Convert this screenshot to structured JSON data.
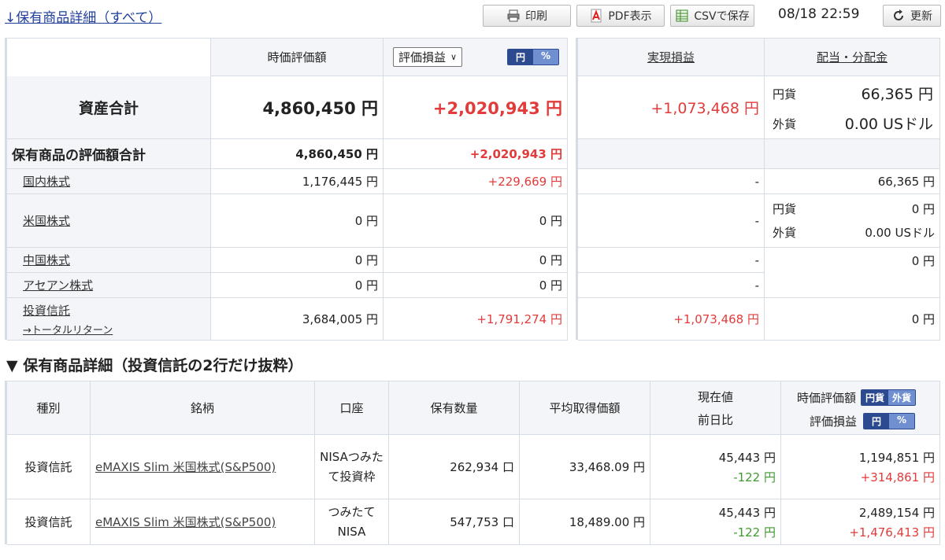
{
  "top": {
    "link": "↓保有商品詳細（すべて）",
    "print": "印刷",
    "pdf": "PDF表示",
    "csv": "CSVで保存",
    "timestamp": "08/18 22:59",
    "refresh": "更新"
  },
  "summary": {
    "col_market_value": "時価評価額",
    "col_pl_select": "評価損益",
    "toggle_yen": "円",
    "toggle_pct": "%",
    "col_realized": "実現損益",
    "col_dividend": "配当・分配金",
    "total_label": "資産合計",
    "total_value": "4,860,450 円",
    "total_pl": "+2,020,943 円",
    "total_realized": "+1,073,468 円",
    "div_yen_label": "円貨",
    "div_yen_value": "66,365 円",
    "div_fx_label": "外貨",
    "div_fx_value": "0.00 USドル",
    "holdings_label": "保有商品の評価額合計",
    "holdings_value": "4,860,450 円",
    "holdings_pl": "+2,020,943 円",
    "rows": [
      {
        "label": "国内株式",
        "value": "1,176,445 円",
        "pl": "+229,669 円",
        "realized": "-",
        "dividend": "66,365 円"
      },
      {
        "label": "米国株式",
        "value": "0 円",
        "pl": "0 円",
        "realized": "-",
        "div_yen_label": "円貨",
        "div_yen": "0 円",
        "div_fx_label": "外貨",
        "div_fx": "0.00 USドル"
      },
      {
        "label": "中国株式",
        "value": "0 円",
        "pl": "0 円",
        "realized": "-",
        "dividend": "0 円"
      },
      {
        "label": "アセアン株式",
        "value": "0 円",
        "pl": "0 円",
        "realized": "-"
      },
      {
        "label": "投資信託",
        "sublink": "→トータルリターン",
        "value": "3,684,005 円",
        "pl": "+1,791,274 円",
        "realized": "+1,073,468 円",
        "dividend": "0 円"
      }
    ]
  },
  "detail": {
    "section_title": "▼ 保有商品詳細（投資信託の2行だけ抜粋）",
    "headers": {
      "type": "種別",
      "name": "銘柄",
      "account": "口座",
      "quantity": "保有数量",
      "avg_cost": "平均取得価額",
      "price": "現在値",
      "day_change": "前日比",
      "market_value": "時価評価額",
      "pl": "評価損益",
      "toggle_jpy": "円貨",
      "toggle_fx": "外貨",
      "toggle_yen": "円",
      "toggle_pct": "%"
    },
    "rows": [
      {
        "type": "投資信託",
        "name": "eMAXIS Slim 米国株式(S&P500)",
        "account": "NISAつみたて投資枠",
        "quantity": "262,934 口",
        "avg_cost": "33,468.09 円",
        "price": "45,443 円",
        "change": "-122 円",
        "value": "1,194,851 円",
        "pl": "+314,861 円"
      },
      {
        "type": "投資信託",
        "name": "eMAXIS Slim 米国株式(S&P500)",
        "account": "つみたてNISA",
        "quantity": "547,753 口",
        "avg_cost": "18,489.00 円",
        "price": "45,443 円",
        "change": "-122 円",
        "value": "2,489,154 円",
        "pl": "+1,476,413 円"
      }
    ]
  },
  "colors": {
    "positive": "#e23b3b",
    "negative": "#3f9a2f",
    "accent": "#2c4a8f",
    "header_bg": "#f3f5f8"
  }
}
